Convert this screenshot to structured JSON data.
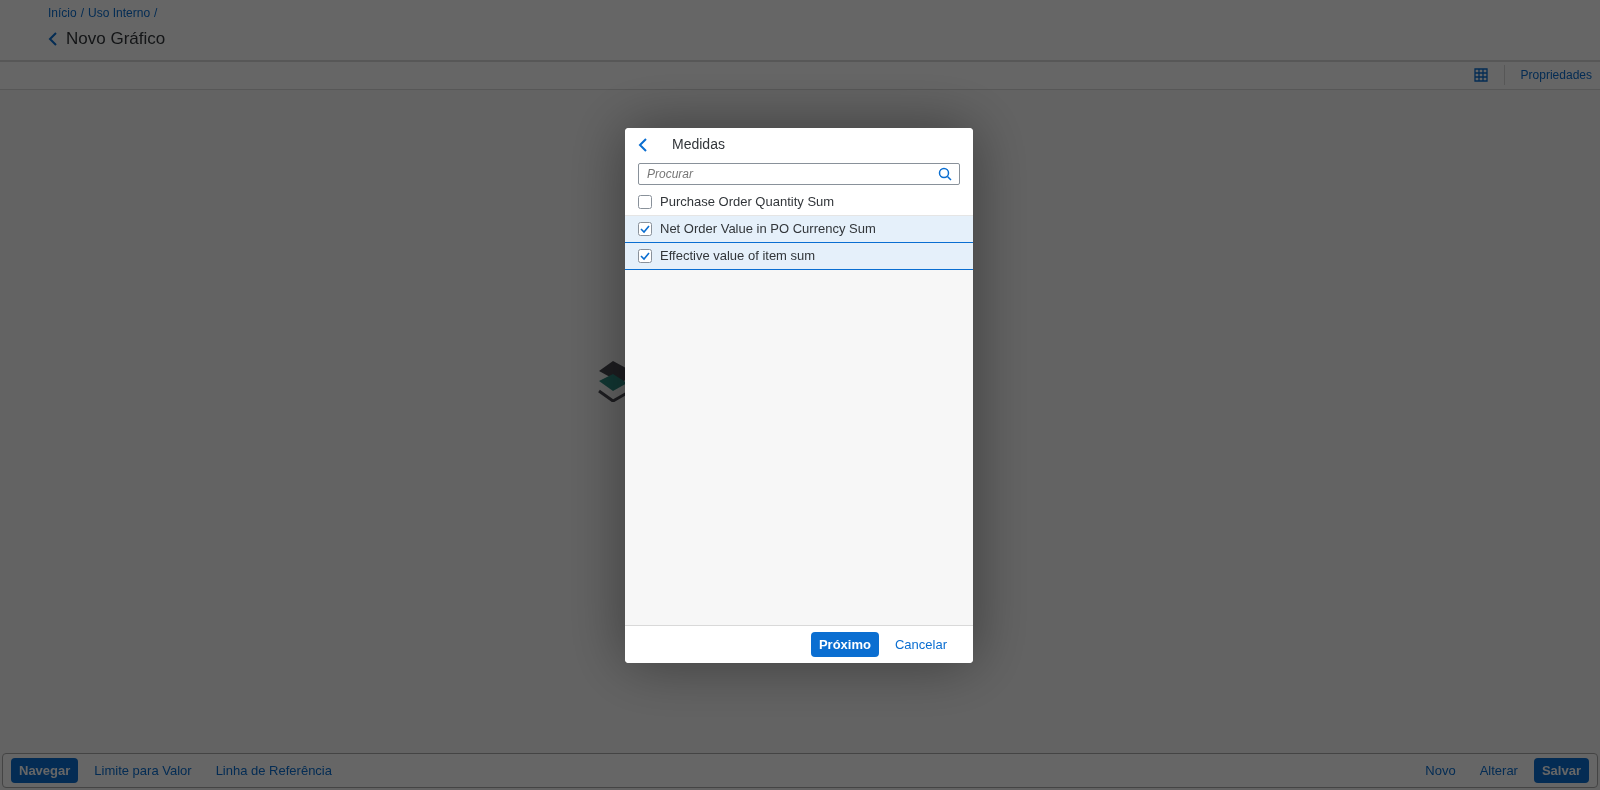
{
  "breadcrumbs": [
    {
      "label": "Início",
      "separator": "/"
    },
    {
      "label": "Uso Interno",
      "separator": "/"
    }
  ],
  "page_title": "Novo Gráfico",
  "toolbar": {
    "properties_label": "Propriedades"
  },
  "dialog": {
    "title": "Medidas",
    "search": {
      "placeholder": "Procurar"
    },
    "items": [
      {
        "label": "Purchase Order Quantity Sum",
        "checked": false
      },
      {
        "label": "Net Order Value in PO Currency Sum",
        "checked": true
      },
      {
        "label": "Effective value of item sum",
        "checked": true
      }
    ],
    "buttons": [
      {
        "label": "Próximo",
        "kind": "primary"
      },
      {
        "label": "Cancelar",
        "kind": "link"
      }
    ]
  },
  "footer": {
    "left": [
      {
        "label": "Navegar",
        "kind": "primary"
      },
      {
        "label": "Limite para Valor",
        "kind": "link"
      },
      {
        "label": "Linha de Referência",
        "kind": "link"
      }
    ],
    "right": [
      {
        "label": "Novo",
        "kind": "link"
      },
      {
        "label": "Alterar",
        "kind": "link"
      },
      {
        "label": "Salvar",
        "kind": "primary"
      }
    ]
  }
}
